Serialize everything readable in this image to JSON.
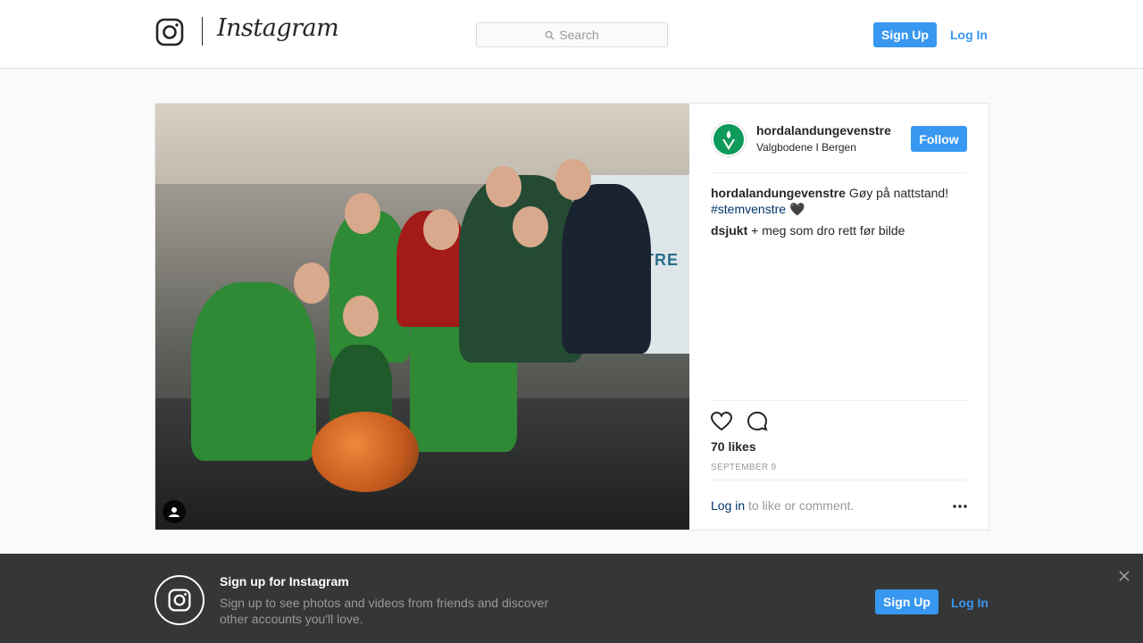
{
  "header": {
    "brand": "Instagram",
    "search_placeholder": "Search",
    "signup_label": "Sign Up",
    "login_label": "Log In"
  },
  "post": {
    "owner": "hordalandungevenstre",
    "location": "Valgbodene I Bergen",
    "follow_label": "Follow",
    "caption": {
      "user": "hordalandungevenstre",
      "text": "Gøy på nattstand!",
      "hashtag": "#stemvenstre",
      "emoji": "🖤"
    },
    "comments": [
      {
        "user": "dsjukt",
        "text": "+ meg som dro rett før bilde"
      }
    ],
    "likes": "70 likes",
    "date": "SEPTEMBER 9",
    "login_link": "Log in",
    "login_suffix": "to like or comment."
  },
  "signup_banner": {
    "title": "Sign up for Instagram",
    "text": "Sign up to see photos and videos from friends and discover other accounts you'll love.",
    "signup_label": "Sign Up",
    "login_label": "Log In"
  },
  "colors": {
    "accent": "#3897f0",
    "link_dark": "#003569",
    "banner_bg": "#363636"
  },
  "icons": [
    "instagram-glyph-icon",
    "search-icon",
    "heart-icon",
    "comment-icon",
    "more-icon",
    "user-tag-icon",
    "close-icon"
  ]
}
